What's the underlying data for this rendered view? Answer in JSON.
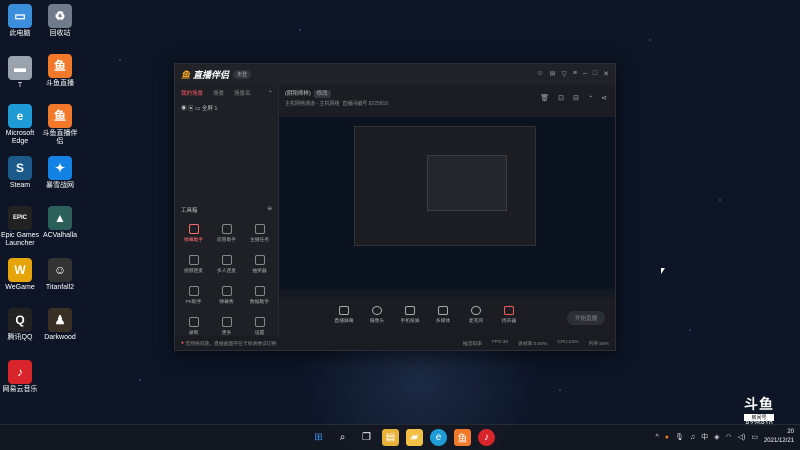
{
  "desktop": {
    "icons": [
      {
        "label": "此电脑",
        "glyph": "▭",
        "color": "#3b8edb"
      },
      {
        "label": "回收站",
        "glyph": "♻",
        "color": "#6f7a8a"
      },
      {
        "label": "T",
        "glyph": "▬",
        "color": "#9aa3ad"
      },
      {
        "label": "斗鱼直播",
        "glyph": "鱼",
        "color": "#f2792a"
      },
      {
        "label": "Microsoft Edge",
        "glyph": "e",
        "color": "#1f9bd6"
      },
      {
        "label": "斗鱼直播伴侣",
        "glyph": "鱼",
        "color": "#f2792a"
      },
      {
        "label": "Steam",
        "glyph": "S",
        "color": "#1b5a8a"
      },
      {
        "label": "暴雪战网",
        "glyph": "✦",
        "color": "#1481e4"
      },
      {
        "label": "Epic Games Launcher",
        "glyph": "EPIC",
        "color": "#222"
      },
      {
        "label": "ACValhalla",
        "glyph": "▲",
        "color": "#2b5f5a"
      },
      {
        "label": "WeGame",
        "glyph": "W",
        "color": "#e5a40a"
      },
      {
        "label": "Titanfall2",
        "glyph": "☺",
        "color": "#333"
      },
      {
        "label": "腾讯QQ",
        "glyph": "Q",
        "color": "#222"
      },
      {
        "label": "Darkwood",
        "glyph": "♟",
        "color": "#3b3025"
      },
      {
        "label": "网易云音乐",
        "glyph": "♪",
        "color": "#d8252b"
      }
    ]
  },
  "app": {
    "title": "直播伴侣",
    "title_badge": "未登",
    "scene_tabs": [
      "我的场景",
      "场景",
      "场景名"
    ],
    "scene_row": "全屏 1",
    "tools_header": "工具箱",
    "tools": [
      {
        "label": "弹幕助手",
        "hot": true
      },
      {
        "label": "房管助手",
        "hot": false
      },
      {
        "label": "主播任务",
        "hot": false
      },
      {
        "label": "视频连麦",
        "hot": false
      },
      {
        "label": "多人连麦",
        "hot": false
      },
      {
        "label": "抽奖器",
        "hot": false
      },
      {
        "label": "PK助手",
        "hot": false
      },
      {
        "label": "弹幕秀",
        "hot": false
      },
      {
        "label": "数据助手",
        "hot": false
      },
      {
        "label": "录制",
        "hot": false
      },
      {
        "label": "更多",
        "hot": false
      },
      {
        "label": "设置",
        "hot": false
      }
    ],
    "room": {
      "name": "(阴阳师样)",
      "tag": "修改",
      "sub": "主机网络通道 - 主机网络",
      "room_label": "直播间编号",
      "room_number": "8225810"
    },
    "bottom_tools": [
      "直播屏幕",
      "摄像头",
      "手机投屏",
      "多媒体",
      "麦克风",
      "扬声器"
    ],
    "live_button": "开始直播",
    "status_warning": "无网络问题，直播画面存在卡顿请尝试切换",
    "status_stats": [
      "推流码率",
      "FPS:30",
      "丢帧率:0.00%",
      "CPU:24%",
      "内存:56%"
    ]
  },
  "watermark": {
    "logo": "斗鱼",
    "room_label": "房间号",
    "room_number": "8225810"
  },
  "taskbar": {
    "apps": [
      {
        "name": "windows-start-icon",
        "glyph": "⊞",
        "color": "#3a8ee6"
      },
      {
        "name": "search-icon",
        "glyph": "⌕",
        "color": "transparent"
      },
      {
        "name": "task-view-icon",
        "glyph": "❐",
        "color": "transparent"
      },
      {
        "name": "file-explorer-icon",
        "glyph": "▤",
        "color": "#e8b23a"
      },
      {
        "name": "folder-icon",
        "glyph": "▰",
        "color": "#f3c046"
      },
      {
        "name": "edge-icon",
        "glyph": "e",
        "color": "#1f9bd6"
      },
      {
        "name": "douyu-icon",
        "glyph": "鱼",
        "color": "#f2792a"
      },
      {
        "name": "netease-music-icon",
        "glyph": "♪",
        "color": "#d8252b"
      }
    ],
    "tray_lang": "中",
    "time": "20",
    "date": "2021/12/21"
  }
}
